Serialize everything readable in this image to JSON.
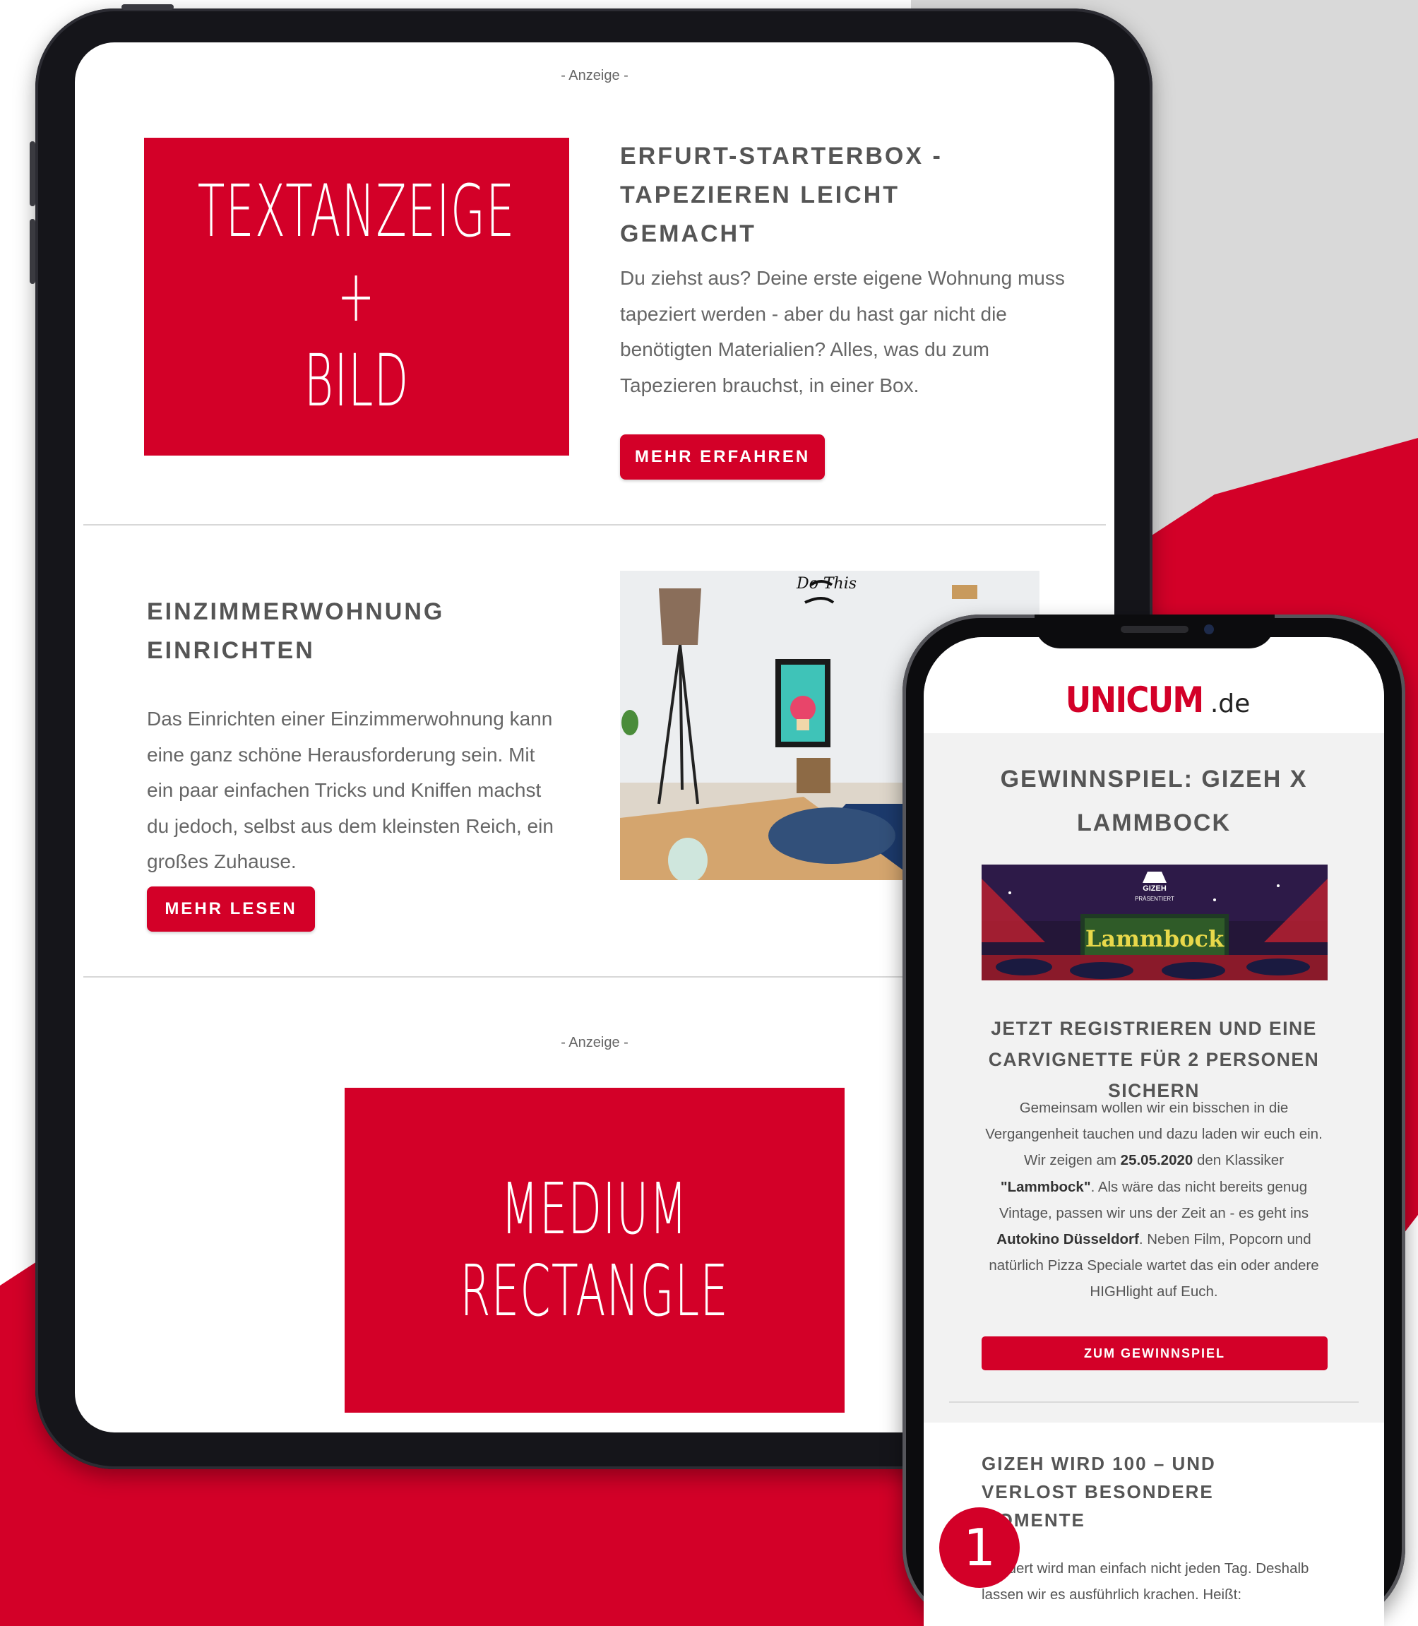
{
  "colors": {
    "brand_red": "#d30028",
    "background_gray": "#d9d9d9",
    "device_black": "#15151a"
  },
  "tablet": {
    "ad_label_top": "- Anzeige -",
    "text_ad_box": {
      "line1": "TEXTANZEIGE",
      "line2": "+",
      "line3": "BILD"
    },
    "article1": {
      "title": "ERFURT-STARTERBOX - TAPEZIEREN LEICHT GEMACHT",
      "body": "Du ziehst aus? Deine erste eigene Wohnung muss tapeziert werden - aber du hast gar nicht die benötigten Materialien? Alles, was du zum Tapezieren brauchst, in einer Box.",
      "button": "MEHR ERFAHREN"
    },
    "article2": {
      "title": "EINZIMMERWOHNUNG EINRICHTEN",
      "body": "Das Einrichten einer Einzimmerwohnung kann eine ganz schöne Herausforderung sein. Mit ein paar einfachen Tricks und Kniffen machst du jedoch, selbst aus dem kleinsten Reich, ein großes Zuhause.",
      "button": "MEHR LESEN",
      "photo_wall_text": "Do This"
    },
    "ad_label_bottom": "- Anzeige -",
    "medium_rectangle": {
      "line1": "MEDIUM",
      "line2": "RECTANGLE"
    }
  },
  "phone": {
    "logo_main": "UNICUM",
    "logo_suffix": ".de",
    "title": "GEWINNSPIEL: GIZEH X LAMMBOCK",
    "banner": {
      "brand": "GIZEH",
      "subtitle": "PRÄSENTIERT",
      "screen_text": "Lammbock"
    },
    "subtitle": "JETZT REGISTRIEREN UND EINE CARVIGNETTE FÜR 2 PERSONEN SICHERN",
    "body": {
      "p1": "Gemeinsam wollen wir ein bisschen in die Vergangenheit tauchen und dazu laden wir euch ein. Wir zeigen am ",
      "date": "25.05.2020",
      "p2": " den Klassiker ",
      "film": "\"Lammbock\"",
      "p3": ". Als wäre das nicht bereits genug Vintage, passen wir uns der Zeit an - es geht ins ",
      "venue": "Autokino Düsseldorf",
      "p4": ". Neben Film, Popcorn und natürlich Pizza Speciale wartet das ein oder andere HIGHlight auf Euch."
    },
    "button": "ZUM GEWINNSPIEL",
    "article2_title": "GIZEH WIRD 100 – UND VERLOST BESONDERE MOMENTE",
    "article2_body": "Hundert wird man einfach nicht jeden Tag. Deshalb lassen wir es ausführlich krachen. Heißt:"
  },
  "badge": "1"
}
